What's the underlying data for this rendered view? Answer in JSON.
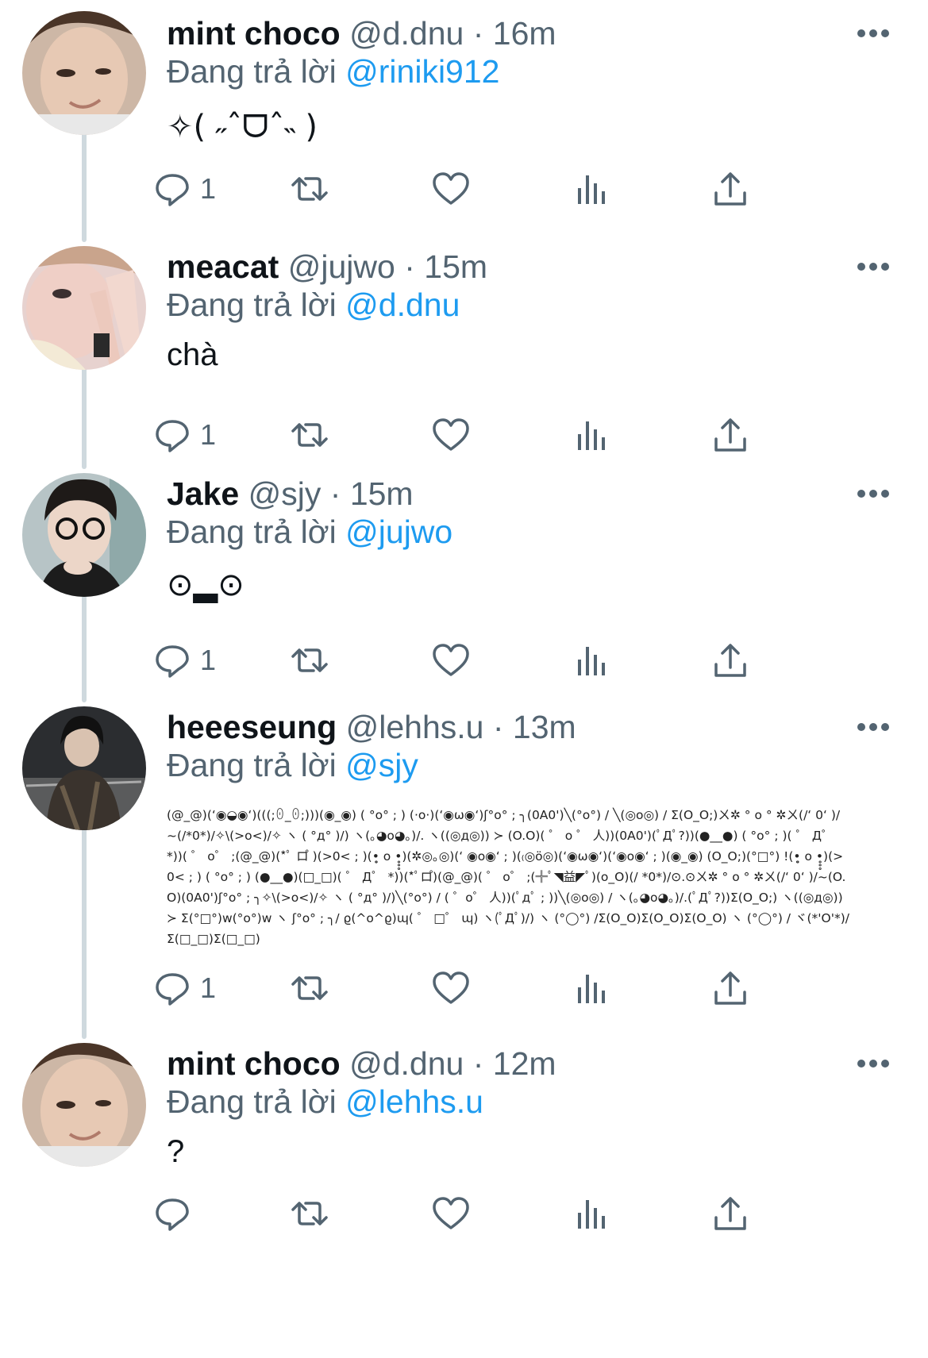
{
  "reply_prefix": "Đang trả lời",
  "colors": {
    "link": "#1d9bf0",
    "secondary": "#536471",
    "text": "#0f1419",
    "thread_line": "#cfd9de"
  },
  "tweets": [
    {
      "name": "mint choco",
      "handle": "@d.dnu",
      "dot": "·",
      "time": "16m",
      "reply_to": "@riniki912",
      "text": "✧( ˶ˆᗜˆ˵ )",
      "reply_count": "1"
    },
    {
      "name": "meacat",
      "handle": "@jujwo",
      "dot": "·",
      "time": "15m",
      "reply_to": "@d.dnu",
      "text": "chà",
      "reply_count": "1"
    },
    {
      "name": "Jake",
      "handle": "@sjy",
      "dot": "·",
      "time": "15m",
      "reply_to": "@jujwo",
      "text": "⊙▂⊙",
      "reply_count": "1"
    },
    {
      "name": "heeeseung",
      "handle": "@lehhs.u",
      "dot": "·",
      "time": "13m",
      "reply_to": "@sjy",
      "text": "(@_@)(ʻ◉◒◉ʻ)(((;ꏿ_ꏿ;)))(◉_◉) ( °o° ; ) (·o·)(ʻ◉ω◉ʻ)ʃ°o° ; ╮(0A0')╲(°o°) / ╲(◎o◎) / Σ(O_O;)ㄨ✲ ° o ° ✲ㄨ(/ʻ 0ʻ )/~(/*0*)/✧\\(>o<)/✧ ヽ ( °д° )/) ヽ(｡◕o◕｡)/. ヽ((◎д◎)) ≻ (O.O)( ゜ o ゜ 人))(0A0')(ﾟДﾟ?))(●__●) ( °o° ; )( ゜ Д゜ *))( ゜ o゜ ;(@_@)(*ﾟ ロ゚ )(>0< ; )(•̥̥̥ o •̥̥̥)(✲◎｡◎)(ʻ ◉o◉ʻ ; )(₍◎ö◎)(ʻ◉ω◉ʻ)(ʻ◉o◉ʻ ; )(◉_◉) (O_O;)(°□°) !(•̥̥̥ o •̥̥̥)(>0< ; ) ( °o° ; ) (●__●)(□_□)( ゜ Д゜ *))(*ﾟロ゚)(@_@)( ゜ o゜ ;(╬ﾟ◥益◤ﾟ)(o_O)(/ *0*)/⊙.⊙ㄨ✲ ° o ° ✲ㄨ(/ʻ 0ʻ )/~(O.O)(0A0')ʃ°o° ; ╮✧\\(>o<)/✧ ヽ ( °д° )/)╲(°o°) / ( ゜o゜ 人))(ﾟдﾟ ; ))╲(◎o◎) / ヽ(｡◕o◕｡)/.(ﾟДﾟ?))Σ(O_O;) ヽ((◎д◎)) ≻ Σ(°□°)w(°o°)w ヽ ʃ°o° ; ╮/ ϱ(^o^ϱ)ɰ( ゜ □゜ ɰ) ヽ(ﾟДﾟ)/) ヽ (°◯°) /Σ(O_O)Σ(O_O)Σ(O_O) ヽ (°◯°) / ヾ(*'O'*)/Σ(□_□)Σ(□_□)",
      "reply_count": "1"
    },
    {
      "name": "mint choco",
      "handle": "@d.dnu",
      "dot": "·",
      "time": "12m",
      "reply_to": "@lehhs.u",
      "text": "?",
      "reply_count": ""
    }
  ]
}
